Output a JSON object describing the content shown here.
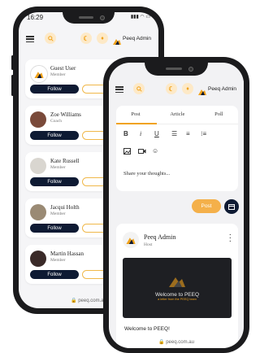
{
  "back_phone": {
    "status_time": "16:29",
    "topbar": {
      "user_name": "Peeq Admin"
    },
    "users": [
      {
        "name": "Guest User",
        "role": "Member",
        "follow_label": "Follow"
      },
      {
        "name": "Zoe Williams",
        "role": "Coach",
        "follow_label": "Follow"
      },
      {
        "name": "Kate Russell",
        "role": "Member",
        "follow_label": "Follow"
      },
      {
        "name": "Jacqui Holth",
        "role": "Member",
        "follow_label": "Follow"
      },
      {
        "name": "Martin Hassan",
        "role": "Member",
        "follow_label": "Follow"
      }
    ],
    "url": "peeq.com.au"
  },
  "front_phone": {
    "topbar": {
      "user_name": "Peeq Admin"
    },
    "composer": {
      "tabs": [
        "Post",
        "Article",
        "Poll"
      ],
      "active_tab": "Post",
      "placeholder": "Share your thoughts...",
      "post_label": "Post"
    },
    "feed_post": {
      "author": "Peeq Admin",
      "role": "Host",
      "banner_title": "Welcome to PEEQ",
      "banner_subtitle": "a letter from the PEEQ team",
      "caption": "Welcome to PEEQ!"
    },
    "url": "peeq.com.au"
  },
  "colors": {
    "accent": "#f0a21b",
    "navy": "#0e1a33",
    "post_button": "#f4b04a"
  },
  "icons": [
    "menu-icon",
    "search-icon",
    "sun-icon",
    "bell-icon",
    "logo-icon",
    "bold-icon",
    "italic-icon",
    "underline-icon",
    "align-left-icon",
    "align-center-icon",
    "list-icon",
    "image-icon",
    "video-icon",
    "emoji-icon",
    "calendar-icon",
    "kebab-icon",
    "lock-icon"
  ]
}
